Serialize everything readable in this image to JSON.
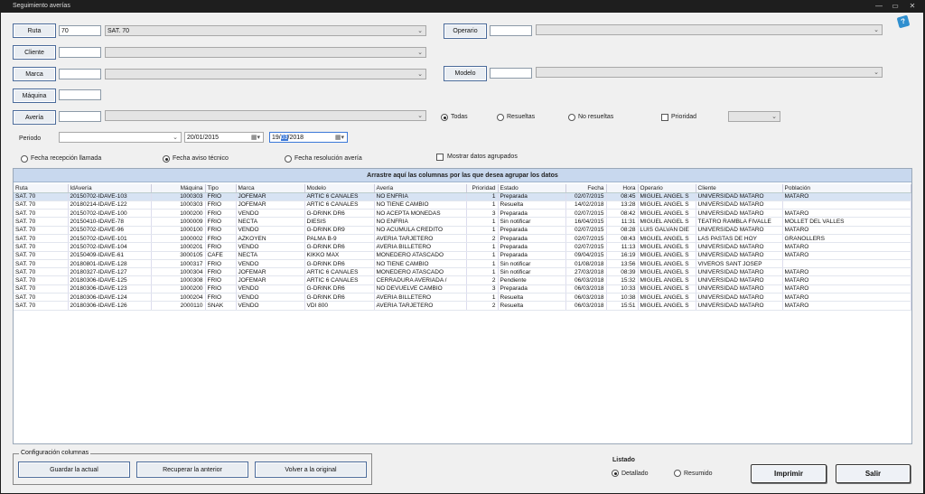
{
  "window": {
    "title": "Seguimiento averías"
  },
  "filters": {
    "ruta_label": "Ruta",
    "ruta_code": "70",
    "ruta_name": "SAT. 70",
    "cliente_label": "Cliente",
    "marca_label": "Marca",
    "maquina_label": "Máquina",
    "averia_label": "Avería",
    "operario_label": "Operario",
    "modelo_label": "Modelo",
    "periodo_label": "Periodo",
    "fecha_desde": "20/01/2015",
    "fecha_hasta_pre": "19/",
    "fecha_hasta_sel": "03",
    "fecha_hasta_post": "/2018"
  },
  "estado": {
    "todas": "Todas",
    "resueltas": "Resueltas",
    "no_resueltas": "No resueltas",
    "prioridad": "Prioridad"
  },
  "fecha_tipo": {
    "recepcion": "Fecha recepción llamada",
    "aviso": "Fecha aviso técnico",
    "resolucion": "Fecha resolución avería",
    "agrupados": "Mostrar datos agrupados"
  },
  "grid": {
    "group_hint": "Arrastre aquí las columnas por las que desea agrupar los datos",
    "columns": [
      "Ruta",
      "IdAvería",
      "Máquina",
      "Tipo",
      "Marca",
      "Modelo",
      "Avería",
      "Prioridad",
      "Estado",
      "Fecha",
      "Hora",
      "Operario",
      "Cliente",
      "Población"
    ],
    "rows": [
      [
        "SAT. 70",
        "20150702-IDAVE-103",
        "1000303",
        "FRIO",
        "JOFEMAR",
        "ARTIC 6 CANALES",
        "NO ENFRIA",
        "1",
        "Preparada",
        "02/07/2015",
        "08:45",
        "MIGUEL ANGEL S",
        "UNIVERSIDAD MATARO",
        "MATARO"
      ],
      [
        "SAT. 70",
        "20180214-IDAVE-122",
        "1000303",
        "FRIO",
        "JOFEMAR",
        "ARTIC 6 CANALES",
        "NO TIENE CAMBIO",
        "1",
        "Resuelta",
        "14/02/2018",
        "13:28",
        "MIGUEL ANGEL S",
        "UNIVERSIDAD MATARO",
        ""
      ],
      [
        "SAT. 70",
        "20150702-IDAVE-100",
        "1000200",
        "FRIO",
        "VENDO",
        "G-DRINK DR6",
        "NO ACEPTA MONEDAS",
        "3",
        "Preparada",
        "02/07/2015",
        "08:42",
        "MIGUEL ANGEL S",
        "UNIVERSIDAD MATARO",
        "MATARO"
      ],
      [
        "SAT. 70",
        "20150410-IDAVE-78",
        "1000009",
        "FRIO",
        "NECTA",
        "DIESIS",
        "NO ENFRIA",
        "1",
        "Sin notificar",
        "16/04/2015",
        "11:31",
        "MIGUEL ANGEL S",
        "TEATRO RAMBLA FIVALLE",
        "MOLLET DEL VALLES"
      ],
      [
        "SAT. 70",
        "20150702-IDAVE-96",
        "1000100",
        "FRIO",
        "VENDO",
        "G-DRINK DR9",
        "NO ACUMULA CREDITO",
        "1",
        "Preparada",
        "02/07/2015",
        "08:28",
        "LUIS GALVAN DIE",
        "UNIVERSIDAD MATARO",
        "MATARO"
      ],
      [
        "SAT. 70",
        "20150702-IDAVE-101",
        "1000002",
        "FRIO",
        "AZKOYEN",
        "PALMA B-9",
        "AVERIA TARJETERO",
        "2",
        "Preparada",
        "02/07/2015",
        "08:43",
        "MIGUEL ANGEL S",
        "LAS PASTAS DE HOY",
        "GRANOLLERS"
      ],
      [
        "SAT. 70",
        "20150702-IDAVE-104",
        "1000201",
        "FRIO",
        "VENDO",
        "G-DRINK DR6",
        "AVERIA BILLETERO",
        "1",
        "Preparada",
        "02/07/2015",
        "11:13",
        "MIGUEL ANGEL S",
        "UNIVERSIDAD MATARO",
        "MATARO"
      ],
      [
        "SAT. 70",
        "20150409-IDAVE-61",
        "3000105",
        "CAFE",
        "NECTA",
        "KIKKO MAX",
        "MONEDERO ATASCADO",
        "1",
        "Preparada",
        "09/04/2015",
        "16:19",
        "MIGUEL ANGEL S",
        "UNIVERSIDAD MATARO",
        "MATARO"
      ],
      [
        "SAT. 70",
        "20180801-IDAVE-128",
        "1000317",
        "FRIO",
        "VENDO",
        "G-DRINK DR6",
        "NO TIENE CAMBIO",
        "1",
        "Sin notificar",
        "01/08/2018",
        "13:56",
        "MIGUEL ANGEL S",
        "VIVEROS SANT JOSEP",
        ""
      ],
      [
        "SAT. 70",
        "20180327-IDAVE-127",
        "1000304",
        "FRIO",
        "JOFEMAR",
        "ARTIC 6 CANALES",
        "MONEDERO ATASCADO",
        "1",
        "Sin notificar",
        "27/03/2018",
        "08:39",
        "MIGUEL ANGEL S",
        "UNIVERSIDAD MATARO",
        "MATARO"
      ],
      [
        "SAT. 70",
        "20180306-IDAVE-125",
        "1000308",
        "FRIO",
        "JOFEMAR",
        "ARTIC 6 CANALES",
        "CERRADURA AVERIADA /",
        "2",
        "Pendiente",
        "06/03/2018",
        "15:32",
        "MIGUEL ANGEL S",
        "UNIVERSIDAD MATARO",
        "MATARO"
      ],
      [
        "SAT. 70",
        "20180306-IDAVE-123",
        "1000200",
        "FRIO",
        "VENDO",
        "G-DRINK DR6",
        "NO DEVUELVE CAMBIO",
        "3",
        "Preparada",
        "06/03/2018",
        "10:33",
        "MIGUEL ANGEL S",
        "UNIVERSIDAD MATARO",
        "MATARO"
      ],
      [
        "SAT. 70",
        "20180306-IDAVE-124",
        "1000204",
        "FRIO",
        "VENDO",
        "G-DRINK DR6",
        "AVERIA BILLETERO",
        "1",
        "Resuelta",
        "06/03/2018",
        "10:38",
        "MIGUEL ANGEL S",
        "UNIVERSIDAD MATARO",
        "MATARO"
      ],
      [
        "SAT. 70",
        "20180306-IDAVE-126",
        "2000110",
        "SNAK",
        "VENDO",
        "VDI 800",
        "AVERIA TARJETERO",
        "2",
        "Resuelta",
        "06/03/2018",
        "15:51",
        "MIGUEL ANGEL S",
        "UNIVERSIDAD MATARO",
        "MATARO"
      ]
    ]
  },
  "config": {
    "legend": "Configuración columnas",
    "guardar": "Guardar la actual",
    "recuperar": "Recuperar la anterior",
    "volver": "Volver a la original"
  },
  "listado": {
    "title": "Listado",
    "detallado": "Detallado",
    "resumido": "Resumido"
  },
  "actions": {
    "imprimir": "Imprimir",
    "salir": "Salir"
  }
}
